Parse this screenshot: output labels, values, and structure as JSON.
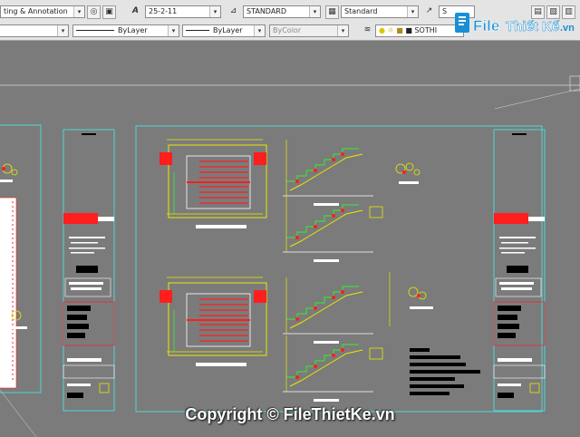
{
  "toolbar1": {
    "workspace": "ting & Annotation",
    "text_style_value": "25-2-11",
    "dim_style_value": "STANDARD",
    "table_style_value": "Standard",
    "multileader_style_value": "S"
  },
  "toolbar2": {
    "layer_value": "",
    "linetype_value": "ByLayer",
    "lineweight_value": "ByLayer",
    "plotstyle_value": "ByColor",
    "layer_state_value": "SOTHI"
  },
  "watermark": {
    "brand_file": "File",
    "brand_rest": "Thiết Kế",
    "brand_suffix": ".vn",
    "copyright": "Copyright © FileThietKe.vn"
  },
  "colors": {
    "canvas": "#7b7b7b",
    "frame": "#4fd6d6",
    "dim_yellow": "#e8e800",
    "red": "#ff1e1e",
    "green": "#3cdc3c",
    "white": "#ffffff"
  },
  "icons": {
    "match_properties": "match-properties-icon",
    "text_style": "text-style-icon",
    "dim_style": "dim-style-icon",
    "table_style": "table-style-icon",
    "layer_manager": "layer-manager-icon"
  }
}
